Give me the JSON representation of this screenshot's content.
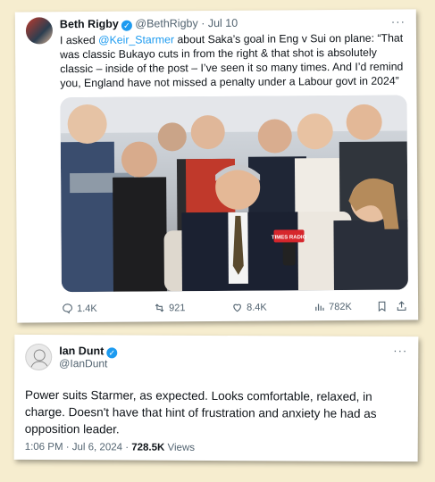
{
  "tweet1": {
    "author_name": "Beth Rigby",
    "handle_time": "@BethRigby · Jul 10",
    "text_before": "I asked ",
    "mention": "@Keir_Starmer",
    "text_after": " about Saka’s goal in Eng v Sui on plane: “That was classic Bukayo cuts in from the right & that shot is absolutely classic – inside of the post – I’ve seen it so many times. And I’d remind you, England have not missed a penalty under a Labour govt in 2024”",
    "more": "···",
    "mic_label": "TIMES RADIO",
    "actions": {
      "replies": "1.4K",
      "reposts": "921",
      "likes": "8.4K",
      "views": "782K"
    }
  },
  "tweet2": {
    "author_name": "Ian Dunt",
    "handle": "@IanDunt",
    "more": "···",
    "text": "Power suits Starmer, as expected. Looks comfortable, relaxed, in charge. Doesn't have that hint of frustration and anxiety he had as opposition leader.",
    "time": "1:06 PM · Jul 6, 2024 · ",
    "views_count": "728.5K",
    "views_label": " Views"
  }
}
